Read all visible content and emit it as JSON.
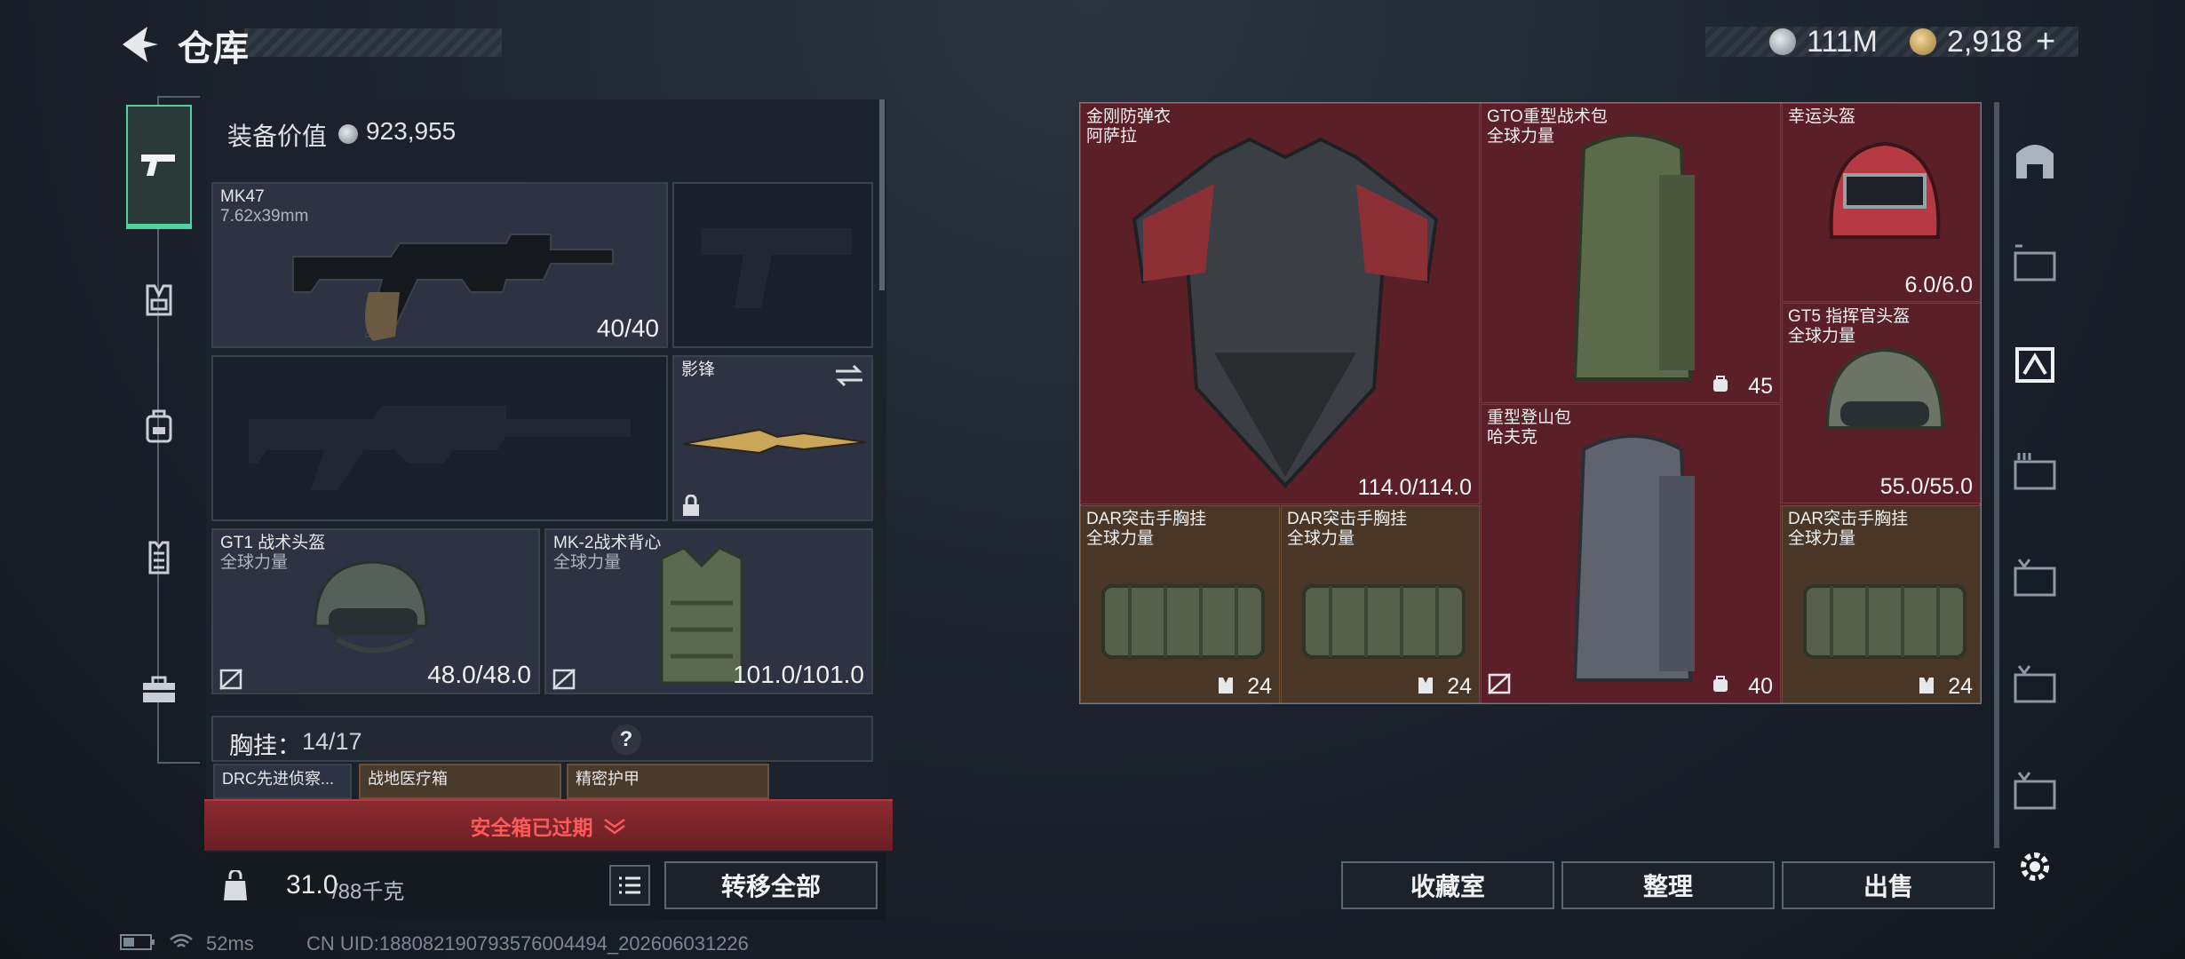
{
  "header": {
    "title": "仓库",
    "back_icon": "back-arrow-icon"
  },
  "currency": {
    "silver": "111M",
    "gold": "2,918",
    "plus": "+"
  },
  "left_tabs": [
    "pistol-icon",
    "chest-rig-icon",
    "backpack-icon",
    "armor-icon",
    "toolbox-icon"
  ],
  "loadout": {
    "value_label": "装备价值",
    "value": "923,955",
    "primary": {
      "name": "MK47",
      "caliber": "7.62x39mm",
      "ammo": "40/40"
    },
    "melee": {
      "name": "影锋"
    },
    "helmet": {
      "name": "GT1 战术头盔",
      "sub": "全球力量",
      "durability": "48.0/48.0"
    },
    "vest": {
      "name": "MK-2战术背心",
      "sub": "全球力量",
      "durability": "101.0/101.0"
    },
    "rig_label": "胸挂：",
    "rig_cap": "14/17",
    "rig_help": "?",
    "rig_items": [
      "DRC先进侦察...",
      "战地医疗箱",
      "精密护甲"
    ],
    "safe_box": "安全箱已过期",
    "weight": "31.0",
    "weight_max": "/88千克",
    "transfer_all": "转移全部"
  },
  "stash": {
    "items": [
      {
        "name": "金刚防弹衣",
        "sub": "阿萨拉",
        "val": "114.0/114.0"
      },
      {
        "name": "GTO重型战术包",
        "sub": "全球力量",
        "val": "45"
      },
      {
        "name": "幸运头盔",
        "sub": "",
        "val": "6.0/6.0"
      },
      {
        "name": "GT5 指挥官头盔",
        "sub": "全球力量",
        "val": "55.0/55.0"
      },
      {
        "name": "重型登山包",
        "sub": "哈夫克",
        "val": "40"
      },
      {
        "name": "DAR突击手胸挂",
        "sub": "全球力量",
        "val": "24"
      },
      {
        "name": "DAR突击手胸挂",
        "sub": "全球力量",
        "val": "24"
      },
      {
        "name": "DAR突击手胸挂",
        "sub": "全球力量",
        "val": "24"
      }
    ]
  },
  "bottom_buttons": {
    "collection": "收藏室",
    "sort": "整理",
    "sell": "出售"
  },
  "status": {
    "ping": "52ms",
    "uid": "CN UID:1880821907935760044​94_202606031226"
  },
  "colors": {
    "accent": "#4fd1a0",
    "stash_red": "#5b2027",
    "stash_tan": "#4a3626",
    "alert_red": "#8c2a30"
  }
}
